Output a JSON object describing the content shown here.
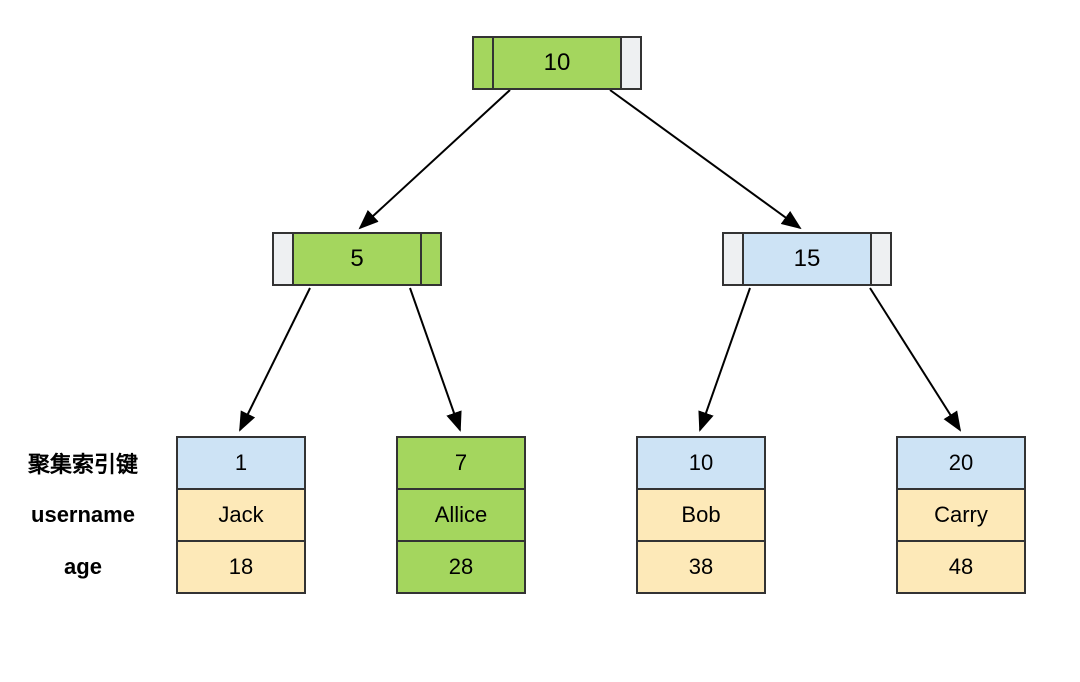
{
  "tree": {
    "root": {
      "value": "10"
    },
    "level2": {
      "left": {
        "value": "5"
      },
      "right": {
        "value": "15"
      }
    },
    "leaves": [
      {
        "key": "1",
        "username": "Jack",
        "age": "18"
      },
      {
        "key": "7",
        "username": "Allice",
        "age": "28"
      },
      {
        "key": "10",
        "username": "Bob",
        "age": "38"
      },
      {
        "key": "20",
        "username": "Carry",
        "age": "48"
      }
    ]
  },
  "labels": {
    "clusteredIndexKey": "聚集索引键",
    "username": "username",
    "age": "age"
  }
}
